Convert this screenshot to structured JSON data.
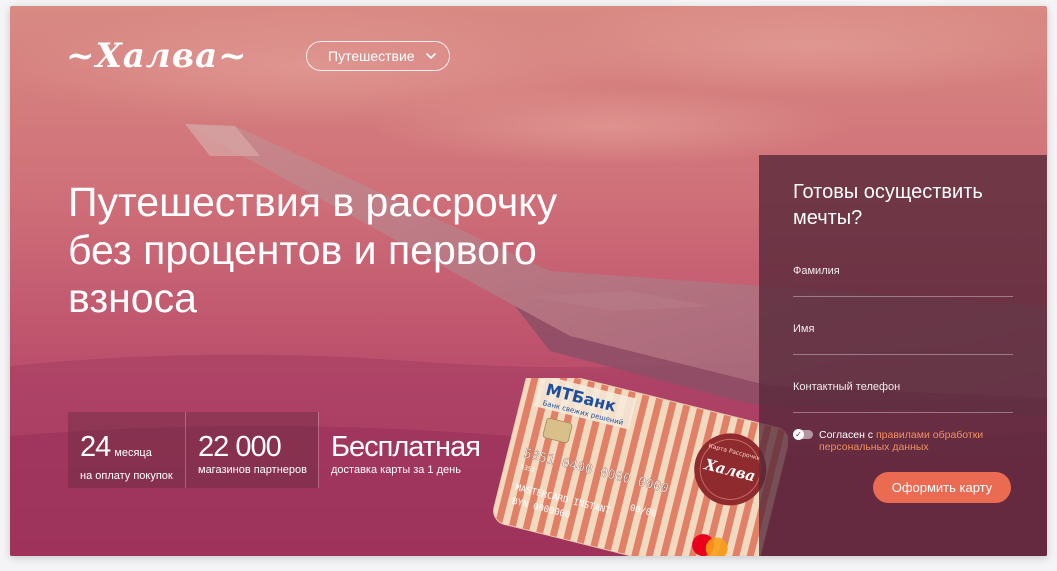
{
  "brand": {
    "logo_text": "~Халва~"
  },
  "nav": {
    "category_dropdown": {
      "selected": "Путешествие"
    }
  },
  "hero": {
    "headline_lines": [
      "Путешествия в рассрочку",
      "без процентов и первого",
      "взноса"
    ]
  },
  "stats": [
    {
      "value": "24",
      "unit": "месяца",
      "caption": "на оплату покупок"
    },
    {
      "value": "22 000",
      "unit": "",
      "caption": "магазинов партнеров"
    },
    {
      "value": "Бесплатная",
      "unit": "",
      "caption": "доставка карты за 1 день"
    }
  ],
  "card": {
    "bank_name": "МТБанк",
    "bank_tagline": "Банк свежих решений",
    "number": "5351 0400 0000 0000",
    "short_code": "5351",
    "expiry": "00/00",
    "card_type": "MASTERCARD INSTANT",
    "holder": "BYN 0000000",
    "seal_top": "Карта Рассрочки",
    "seal_brand": "Халва",
    "payment_network": "mastercard"
  },
  "form": {
    "title": "Готовы осуществить мечты?",
    "fields": [
      {
        "label": "Фамилия",
        "value": ""
      },
      {
        "label": "Имя",
        "value": ""
      },
      {
        "label": "Контактный телефон",
        "value": ""
      }
    ],
    "consent_text": "Согласен с",
    "consent_link": "правилами обработки персональных данных",
    "consent_checked": true,
    "submit_label": "Оформить карту"
  },
  "colors": {
    "accent": "#ea6b52",
    "panel": "#55283a",
    "link": "#f0905e",
    "card_stripe": "#d9523a"
  }
}
